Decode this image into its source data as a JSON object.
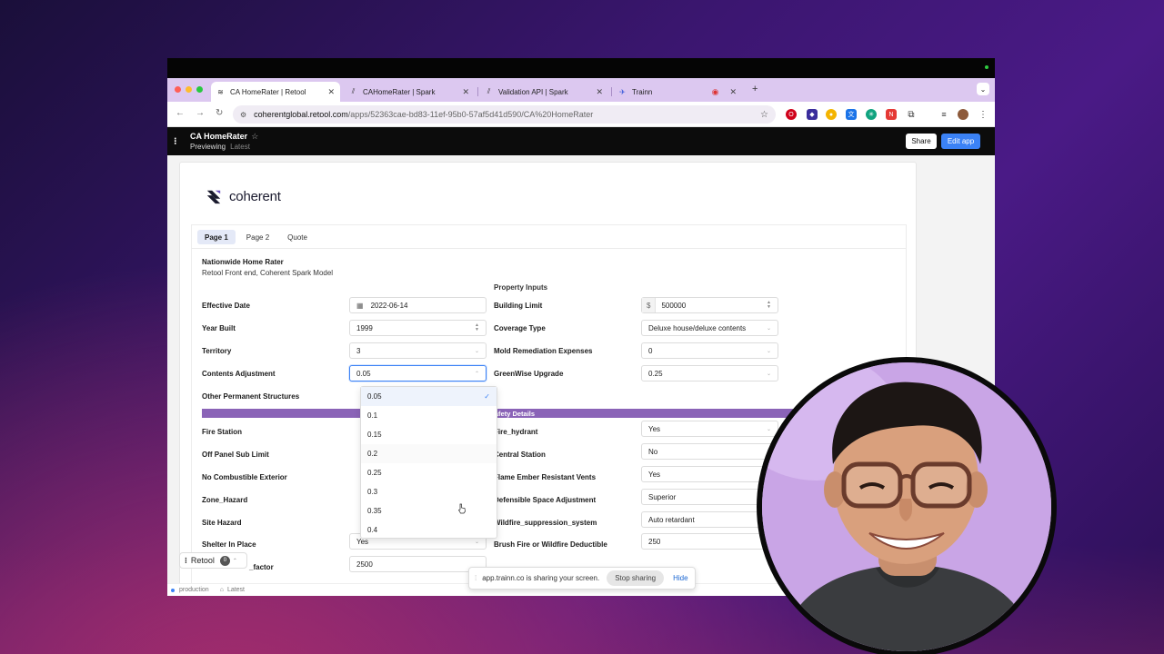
{
  "browser": {
    "tabs": [
      {
        "title": "CA HomeRater | Retool",
        "active": true
      },
      {
        "title": "CAHomeRater | Spark",
        "active": false
      },
      {
        "title": "Validation API | Spark",
        "active": false
      },
      {
        "title": "Trainn",
        "active": false
      }
    ],
    "url_host": "coherentglobal.retool.com",
    "url_path": "/apps/52363cae-bd83-11ef-95b0-57af5d41d590/CA%20HomeRater"
  },
  "retool_header": {
    "app_name": "CA HomeRater",
    "mode": "Previewing",
    "version": "Latest",
    "share_label": "Share",
    "edit_label": "Edit app"
  },
  "brand": {
    "name": "coherent"
  },
  "page_tabs": [
    {
      "label": "Page 1",
      "active": true
    },
    {
      "label": "Page 2",
      "active": false
    },
    {
      "label": "Quote",
      "active": false
    }
  ],
  "section": {
    "title": "Nationwide Home Rater",
    "subtitle": "Retool Front end, Coherent Spark Model",
    "property_inputs_label": "Property Inputs",
    "safety_bar_label": "Property Safety Details"
  },
  "left_fields": [
    {
      "label": "Effective Date",
      "value": "2022-06-14"
    },
    {
      "label": "Year Built",
      "value": "1999"
    },
    {
      "label": "Territory",
      "value": "3"
    },
    {
      "label": "Contents Adjustment",
      "value": "0.05"
    },
    {
      "label": "Other Permanent Structures",
      "value": ""
    }
  ],
  "right_fields": [
    {
      "label": "Building Limit",
      "prefix": "$",
      "value": "500000"
    },
    {
      "label": "Coverage Type",
      "value": "Deluxe house/deluxe contents"
    },
    {
      "label": "Mold Remediation Expenses",
      "value": "0"
    },
    {
      "label": "GreenWise Upgrade",
      "value": "0.25"
    }
  ],
  "safety_left": [
    {
      "label": "Fire Station"
    },
    {
      "label": "Off Panel Sub Limit"
    },
    {
      "label": "No Combustible Exterior"
    },
    {
      "label": "Zone_Hazard"
    },
    {
      "label": "Site Hazard"
    },
    {
      "label": "Shelter In Place",
      "value": "Yes"
    },
    {
      "label": "_factor",
      "value": "2500"
    }
  ],
  "safety_right": [
    {
      "label": "Fire_hydrant",
      "value": "Yes"
    },
    {
      "label": "Central Station",
      "value": "No"
    },
    {
      "label": "Flame Ember Resistant Vents",
      "value": "Yes"
    },
    {
      "label": "Defensible Space Adjustment",
      "value": "Superior"
    },
    {
      "label": "Wildfire_suppression_system",
      "value": "Auto retardant"
    },
    {
      "label": "Brush Fire or Wildfire Deductible",
      "value": "250"
    }
  ],
  "dropdown": {
    "options": [
      "0.05",
      "0.1",
      "0.15",
      "0.2",
      "0.25",
      "0.3",
      "0.35",
      "0.4"
    ],
    "selected": "0.05"
  },
  "retool_chip": {
    "label": "Retool",
    "count": "0"
  },
  "footer": {
    "env": "production",
    "version": "Latest"
  },
  "screen_share": {
    "message": "app.trainn.co is sharing your screen.",
    "stop_label": "Stop sharing",
    "hide_label": "Hide"
  },
  "colors": {
    "accent": "#3b82f6",
    "section_bar": "#8a63b7",
    "tabstrip": "#dcc8f0"
  }
}
